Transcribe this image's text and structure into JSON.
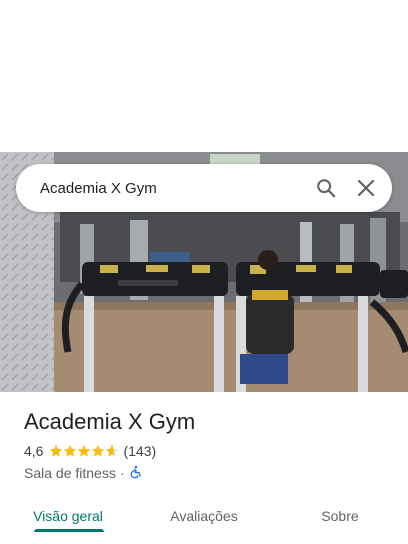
{
  "search": {
    "query": "Academia X Gym",
    "search_icon": "search-icon",
    "close_icon": "close-icon"
  },
  "photo": {
    "subject": "gym-interior-treadmills"
  },
  "place": {
    "name": "Academia X Gym",
    "rating": "4,6",
    "rating_value": 4.6,
    "review_count": "(143)",
    "category": "Sala de fitness",
    "separator": "·",
    "accessibility_icon": "wheelchair-icon"
  },
  "tabs": [
    {
      "label": "Visão geral",
      "active": true
    },
    {
      "label": "Avaliações",
      "active": false
    },
    {
      "label": "Sobre",
      "active": false
    }
  ],
  "colors": {
    "accent": "#00796b",
    "star": "#fbbc04",
    "accessibility": "#1a73e8"
  }
}
